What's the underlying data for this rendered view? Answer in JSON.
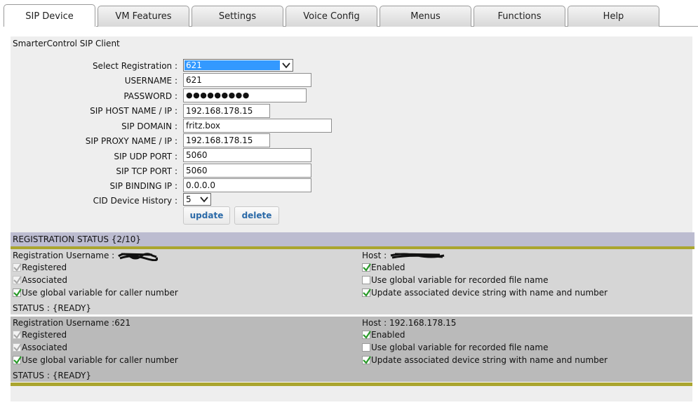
{
  "tabs": [
    {
      "label": "SIP Device"
    },
    {
      "label": "VM Features"
    },
    {
      "label": "Settings"
    },
    {
      "label": "Voice Config"
    },
    {
      "label": "Menus"
    },
    {
      "label": "Functions"
    },
    {
      "label": "Help"
    }
  ],
  "form": {
    "title": "SmarterControl SIP Client",
    "select_registration_label": "Select Registration :",
    "select_registration_value": "621",
    "username_label": "USERNAME :",
    "username_value": "621",
    "password_label": "PASSWORD :",
    "password_value": "●●●●●●●●●",
    "sip_host_label": "SIP HOST NAME / IP :",
    "sip_host_value": "192.168.178.15",
    "sip_domain_label": "SIP DOMAIN :",
    "sip_domain_value": "fritz.box",
    "sip_proxy_label": "SIP PROXY NAME / IP :",
    "sip_proxy_value": "192.168.178.15",
    "udp_port_label": "SIP UDP PORT :",
    "udp_port_value": "5060",
    "tcp_port_label": "SIP TCP PORT :",
    "tcp_port_value": "5060",
    "binding_ip_label": "SIP BINDING IP :",
    "binding_ip_value": "0.0.0.0",
    "cid_history_label": "CID Device History :",
    "cid_history_value": "5",
    "update_label": "update",
    "delete_label": "delete"
  },
  "status": {
    "header": "REGISTRATION STATUS {2/10}",
    "blocks": [
      {
        "username_label": "Registration Username :",
        "username_value": "",
        "host_label": "Host :",
        "host_value": "",
        "registered": "Registered",
        "associated": "Associated",
        "global_caller": "Use global variable for caller number",
        "enabled": "Enabled",
        "global_recorded": "Use global variable for recorded file name",
        "update_assoc": "Update associated device string with name and number",
        "status": "STATUS : {READY}"
      },
      {
        "username_label": "Registration Username :",
        "username_value": "621",
        "host_label": "Host :",
        "host_value": "192.168.178.15",
        "registered": "Registered",
        "associated": "Associated",
        "global_caller": "Use global variable for caller number",
        "enabled": "Enabled",
        "global_recorded": "Use global variable for recorded file name",
        "update_assoc": "Update associated device string with name and number",
        "status": "STATUS : {READY}"
      }
    ]
  },
  "colors": {
    "panel_bg": "#eeeeee",
    "status_header_bg": "#bcbcd0",
    "olive_rule": "#aaa52f",
    "block_light": "#d6d6d6",
    "block_dark": "#bababa",
    "check_green": "#2a9a2a",
    "button_text": "#2b6aa8"
  }
}
